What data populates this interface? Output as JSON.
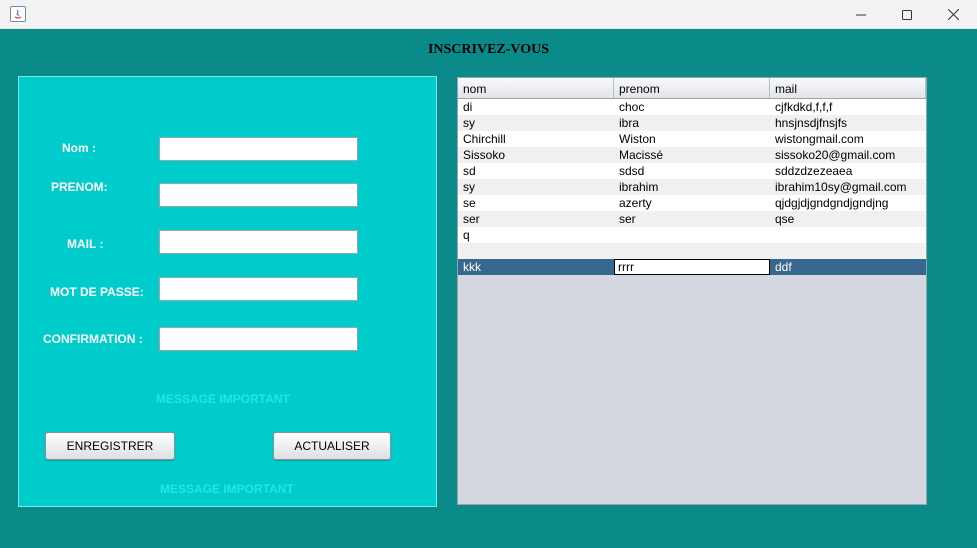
{
  "window": {
    "title": ""
  },
  "heading": "INSCRIVEZ-VOUS",
  "form": {
    "labels": {
      "nom": "Nom :",
      "prenom": "PRENOM:",
      "mail": "MAIL :",
      "password": "MOT DE PASSE:",
      "confirmation": "CONFIRMATION :"
    },
    "values": {
      "nom": "",
      "prenom": "",
      "mail": "",
      "password": "",
      "confirmation": ""
    },
    "message_top": "MESSAGE IMPORTANT",
    "message_bottom": "MESSAGE IMPORTANT",
    "buttons": {
      "save": "ENREGISTRER",
      "refresh": "ACTUALISER"
    }
  },
  "table": {
    "columns": [
      "nom",
      "prenom",
      "mail"
    ],
    "rows": [
      [
        "di",
        "choc",
        "cjfkdkd,f,f,f"
      ],
      [
        "sy",
        "ibra",
        "hnsjnsdjfnsjfs"
      ],
      [
        "Chirchill",
        "Wiston",
        "wistongmail.com"
      ],
      [
        "Sissoko",
        "Macissé",
        "sissoko20@gmail.com"
      ],
      [
        "sd",
        "sdsd",
        "sddzdzezeaea"
      ],
      [
        "sy",
        "ibrahim",
        "ibrahim10sy@gmail.com"
      ],
      [
        "se",
        "azerty",
        "qjdgjdjgndgndjgndjng"
      ],
      [
        "ser",
        "ser",
        "qse"
      ],
      [
        "q",
        "",
        ""
      ],
      [
        "",
        "",
        ""
      ],
      [
        "kkk",
        "rrrr",
        "ddf"
      ]
    ],
    "selected_row": 10,
    "editing_cell": [
      10,
      1
    ]
  },
  "colors": {
    "background": "#0b8a8a",
    "form_panel": "#00cccc",
    "selection": "#38688f"
  }
}
